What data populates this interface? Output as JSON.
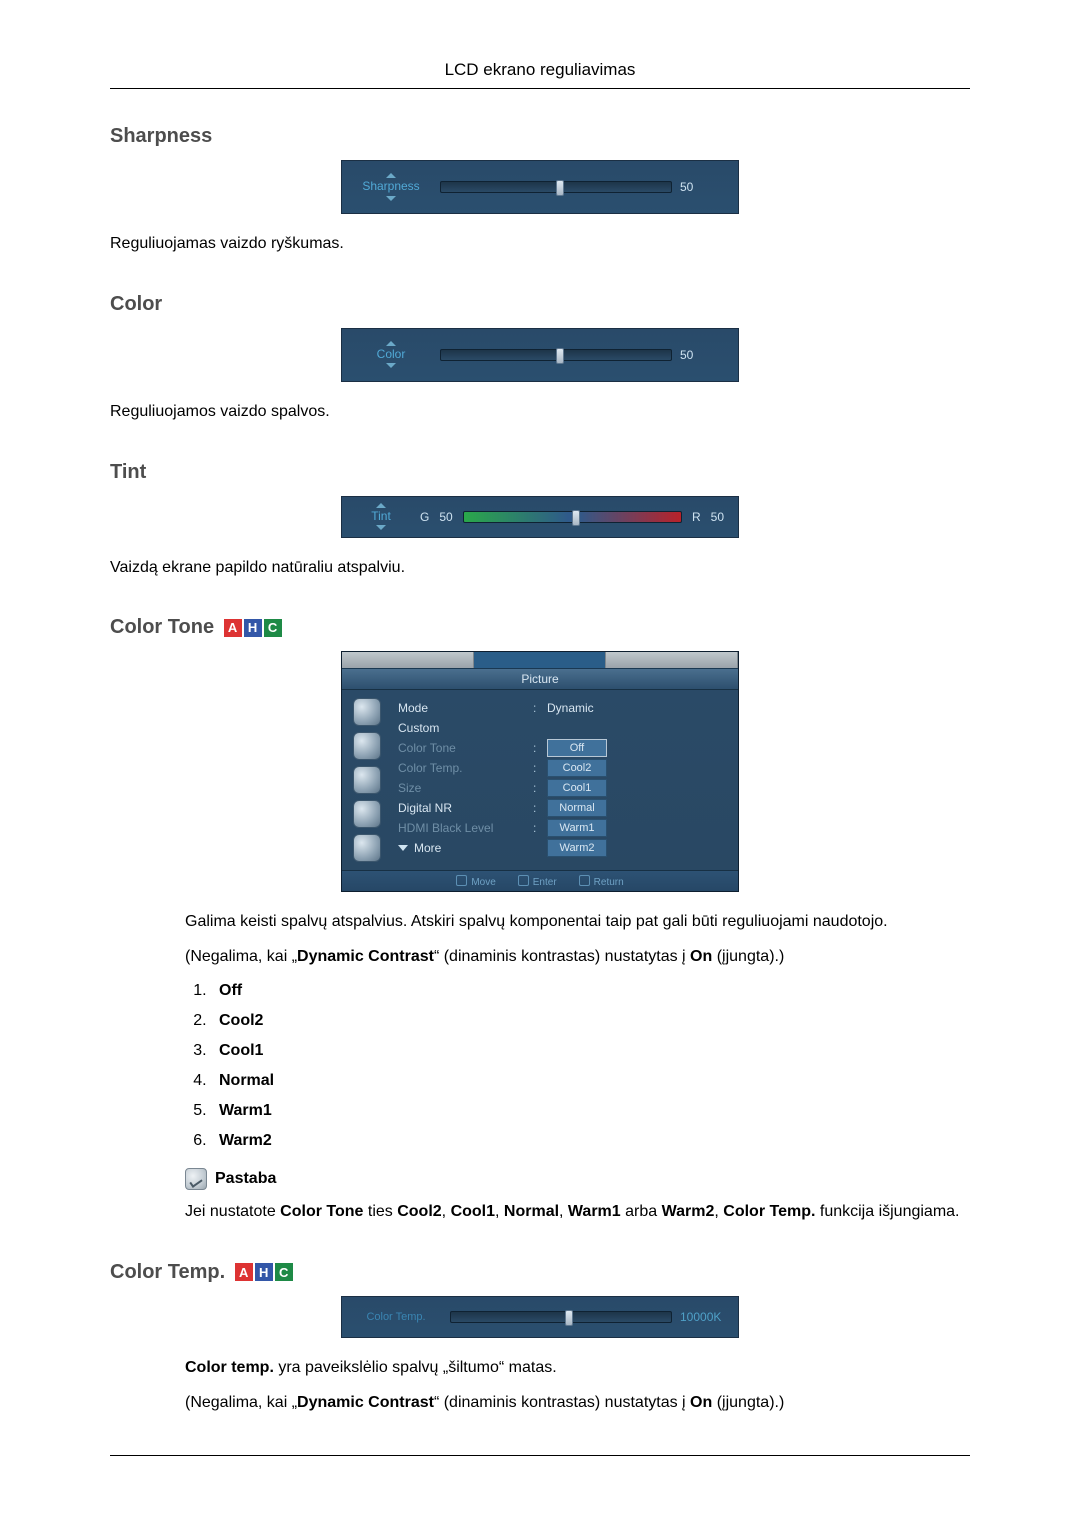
{
  "header": {
    "title": "LCD ekrano reguliavimas"
  },
  "sharpness": {
    "heading": "Sharpness",
    "ui": {
      "label": "Sharpness",
      "value": "50",
      "pos_pct": 50
    },
    "desc": "Reguliuojamas vaizdo ryškumas."
  },
  "color": {
    "heading": "Color",
    "ui": {
      "label": "Color",
      "value": "50",
      "pos_pct": 50
    },
    "desc": "Reguliuojamos vaizdo spalvos."
  },
  "tint": {
    "heading": "Tint",
    "ui": {
      "label": "Tint",
      "left_tag": "G",
      "left_val": "50",
      "right_tag": "R",
      "right_val": "50",
      "pos_pct": 50
    },
    "desc": "Vaizdą ekrane papildo natūraliu atspalviu."
  },
  "color_tone": {
    "heading": "Color Tone",
    "modes": {
      "a": "A",
      "h": "H",
      "c": "C"
    },
    "osd": {
      "title": "Picture",
      "rows": {
        "mode": {
          "k": "Mode",
          "v": "Dynamic"
        },
        "custom": {
          "k": "Custom"
        },
        "color_tone": {
          "k": "Color Tone",
          "v": "Off"
        },
        "color_temp": {
          "k": "Color Temp.",
          "v": "Cool2"
        },
        "size": {
          "k": "Size",
          "v": "Cool1"
        },
        "digital_nr": {
          "k": "Digital NR",
          "v": "Normal"
        },
        "hdmi_black": {
          "k": "HDMI Black Level",
          "v": "Warm1"
        },
        "more": {
          "k": "More",
          "v": "Warm2"
        }
      },
      "footer": {
        "move": "Move",
        "enter": "Enter",
        "return": "Return"
      }
    },
    "desc1": "Galima keisti spalvų atspalvius. Atskiri spalvų komponentai taip pat gali būti reguliuojami naudotojo.",
    "desc2_pre": "(Negalima, kai „",
    "desc2_bold": "Dynamic Contrast",
    "desc2_mid": "“ (dinaminis kontrastas) nustatytas į ",
    "desc2_bold2": "On",
    "desc2_post": " (įjungta).)",
    "options": [
      "Off",
      "Cool2",
      "Cool1",
      "Normal",
      "Warm1",
      "Warm2"
    ],
    "note_label": "Pastaba",
    "note_pre": "Jei nustatote ",
    "note_b1": "Color Tone",
    "note_mid1": " ties ",
    "note_b2": "Cool2",
    "note_sep": ", ",
    "note_b3": "Cool1",
    "note_b4": "Normal",
    "note_b5": "Warm1",
    "note_or": " arba ",
    "note_b6": "Warm2",
    "note_mid2": ", ",
    "note_b7": "Color Temp.",
    "note_post": " funkcija išjungiama."
  },
  "color_temp": {
    "heading": "Color Temp.",
    "modes": {
      "a": "A",
      "h": "H",
      "c": "C"
    },
    "ui": {
      "label": "Color Temp.",
      "value": "10000K",
      "pos_pct": 52
    },
    "desc1_b": "Color temp.",
    "desc1_post": " yra paveikslėlio spalvų „šiltumo“ matas.",
    "desc2_pre": "(Negalima, kai „",
    "desc2_bold": "Dynamic Contrast",
    "desc2_mid": "“ (dinaminis kontrastas) nustatytas į ",
    "desc2_bold2": "On",
    "desc2_post": " (įjungta).)"
  }
}
